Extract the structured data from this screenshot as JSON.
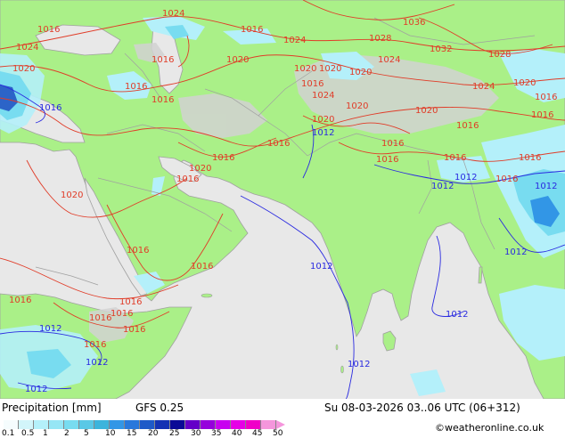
{
  "map": {
    "colors": {
      "land": "#aaf088",
      "sea": "#e8e8e8",
      "highland": "#d2d2d2",
      "border": "#a0a0a0",
      "isobar_high": "#e03c28",
      "isobar_low": "#2a2ae0",
      "precip_light": "#b4f0fa",
      "precip_mid": "#78dcf0",
      "precip_heavy": "#2c64c8"
    },
    "isobar_labels_red": [
      {
        "text": "1024"
      },
      {
        "text": "1024"
      },
      {
        "text": "1020"
      },
      {
        "text": "1016"
      },
      {
        "text": "1020"
      },
      {
        "text": "1016"
      },
      {
        "text": "1016"
      },
      {
        "text": "1020"
      },
      {
        "text": "1024"
      },
      {
        "text": "1028"
      },
      {
        "text": "1036"
      },
      {
        "text": "1032"
      },
      {
        "text": "1028"
      },
      {
        "text": "1024"
      },
      {
        "text": "1020"
      },
      {
        "text": "1024"
      },
      {
        "text": "1020"
      },
      {
        "text": "1016"
      },
      {
        "text": "1020"
      },
      {
        "text": "1024"
      },
      {
        "text": "1020"
      },
      {
        "text": "1020"
      },
      {
        "text": "1016"
      },
      {
        "text": "1016"
      },
      {
        "text": "1020"
      },
      {
        "text": "1016"
      },
      {
        "text": "1016"
      },
      {
        "text": "1016"
      },
      {
        "text": "1020"
      },
      {
        "text": "1016"
      },
      {
        "text": "1016"
      },
      {
        "text": "1016"
      },
      {
        "text": "1016"
      },
      {
        "text": "1016"
      },
      {
        "text": "1016"
      },
      {
        "text": "1016"
      },
      {
        "text": "1020"
      },
      {
        "text": "1016"
      },
      {
        "text": "1016"
      },
      {
        "text": "1016"
      },
      {
        "text": "1016"
      },
      {
        "text": "1016"
      },
      {
        "text": "1016"
      },
      {
        "text": "1016"
      },
      {
        "text": "1016"
      },
      {
        "text": "1016"
      }
    ],
    "isobar_labels_blue": [
      {
        "text": "1016"
      },
      {
        "text": "1012"
      },
      {
        "text": "1012"
      },
      {
        "text": "1012"
      },
      {
        "text": "1012"
      },
      {
        "text": "1012"
      },
      {
        "text": "1012"
      },
      {
        "text": "1012"
      },
      {
        "text": "1012"
      },
      {
        "text": "1012"
      },
      {
        "text": "1012"
      },
      {
        "text": "1012"
      }
    ]
  },
  "footer": {
    "title": "Precipitation [mm]",
    "model": "GFS 0.25",
    "valid": "Su 08-03-2026 03..06 UTC (06+312)",
    "credit": "©weatheronline.co.uk",
    "legend": {
      "colors": [
        "#f5fcfd",
        "#d2f5fa",
        "#b4f0fa",
        "#96e6f5",
        "#78dcf0",
        "#5ac8e6",
        "#3cb4dc",
        "#3296e6",
        "#2878dc",
        "#1e5ac8",
        "#1432b4",
        "#0a0a96",
        "#6400c8",
        "#9600dc",
        "#c800f0",
        "#e600e6",
        "#f000c8",
        "#f596dc"
      ],
      "ticks": [
        "0.1",
        "0.5",
        "1",
        "2",
        "5",
        "10",
        "15",
        "20",
        "25",
        "30",
        "35",
        "40",
        "45",
        "50"
      ]
    }
  }
}
